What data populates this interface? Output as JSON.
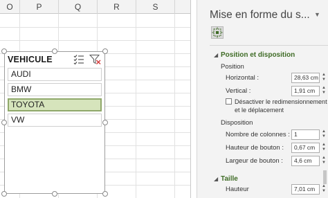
{
  "sheet": {
    "columns": [
      "O",
      "P",
      "Q",
      "R",
      "S"
    ]
  },
  "slicer": {
    "title": "VEHICULE",
    "items": [
      {
        "label": "AUDI",
        "selected": false
      },
      {
        "label": "BMW",
        "selected": false
      },
      {
        "label": "TOYOTA",
        "selected": true
      },
      {
        "label": "VW",
        "selected": false
      }
    ],
    "multi_select_icon": "multi-select-icon",
    "clear_filter_icon": "clear-filter-icon"
  },
  "pane": {
    "title": "Mise en forme du s...",
    "menu_arrow": "▼",
    "icon": "size-properties-icon",
    "position_section": {
      "title": "Position et disposition",
      "position_group": "Position",
      "horizontal_label": "Horizontal :",
      "horizontal_value": "28,63 cm",
      "vertical_label": "Vertical :",
      "vertical_value": "1,91 cm",
      "checkbox_line1": "Désactiver le redimensionnement",
      "checkbox_line2": "et le déplacement",
      "checkbox_checked": false,
      "layout_group": "Disposition",
      "columns_label": "Nombre de colonnes :",
      "columns_value": "1",
      "button_height_label": "Hauteur de bouton :",
      "button_height_value": "0,67 cm",
      "button_width_label": "Largeur de bouton :",
      "button_width_value": "4,6 cm"
    },
    "size_section": {
      "title": "Taille",
      "height_label": "Hauteur",
      "height_value": "7,01 cm"
    }
  },
  "colors": {
    "accent": "#3e6b25",
    "selected_item_bg": "#d6e4bc",
    "selected_item_border": "#8fa86a"
  }
}
